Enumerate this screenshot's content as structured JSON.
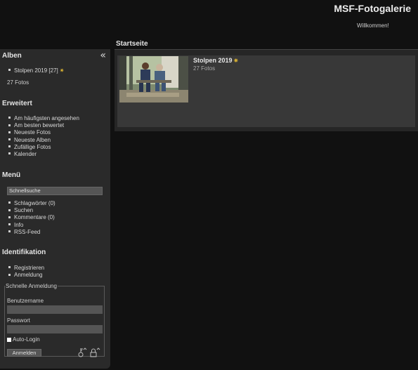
{
  "site": {
    "title": "MSF-Fotogalerie",
    "welcome": "Willkommen!"
  },
  "sidebar": {
    "collapse_icon": "«",
    "albums": {
      "title": "Alben",
      "items": [
        {
          "label": "Stolpen 2019 [27]",
          "badge_icon": "new-star-icon"
        }
      ],
      "count": "27 Fotos"
    },
    "extended": {
      "title": "Erweitert",
      "items": [
        {
          "label": "Am häufigsten angesehen"
        },
        {
          "label": "Am besten bewertet"
        },
        {
          "label": "Neueste Fotos"
        },
        {
          "label": "Neueste Alben"
        },
        {
          "label": "Zufällige Fotos"
        },
        {
          "label": "Kalender"
        }
      ]
    },
    "menu": {
      "title": "Menü",
      "search_placeholder": "Schnellsuche",
      "items": [
        {
          "label": "Schlagwörter (0)"
        },
        {
          "label": "Suchen"
        },
        {
          "label": "Kommentare (0)"
        },
        {
          "label": "Info"
        },
        {
          "label": "RSS-Feed"
        }
      ]
    },
    "identification": {
      "title": "Identifikation",
      "items": [
        {
          "label": "Registrieren"
        },
        {
          "label": "Anmeldung"
        }
      ],
      "quick_login": {
        "legend": "Schnelle Anmeldung",
        "username_label": "Benutzername",
        "username_value": "",
        "password_label": "Passwort",
        "password_value": "",
        "auto_login_label": "Auto-Login",
        "auto_login_checked": false,
        "submit_label": "Anmelden"
      }
    }
  },
  "main": {
    "title": "Startseite",
    "albums": [
      {
        "title": "Stolpen 2019",
        "count": "27 Fotos",
        "badge_icon": "new-star-icon"
      }
    ]
  },
  "colors": {
    "background": "#111111",
    "sidebar": "#2a2a2a",
    "card": "#383838",
    "input": "#555555",
    "star": "#d9b233"
  }
}
